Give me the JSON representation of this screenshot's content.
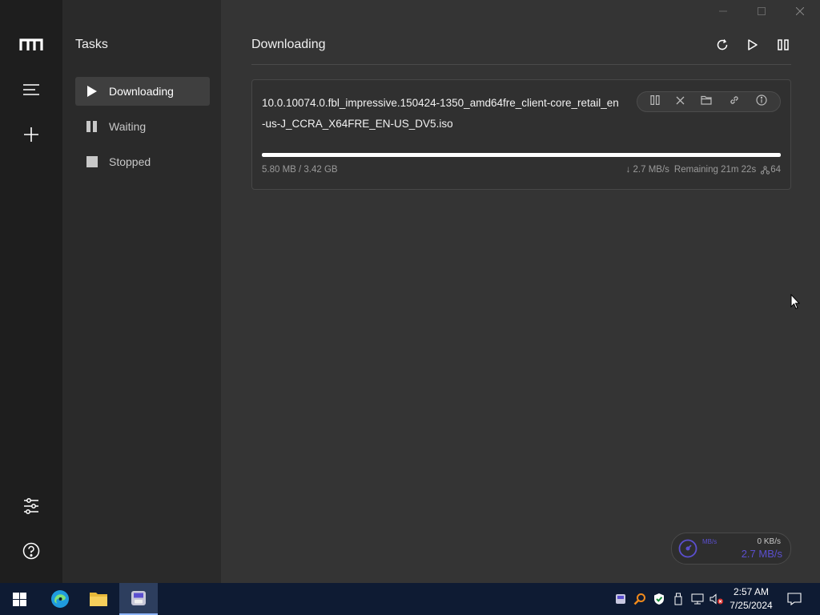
{
  "window": {
    "minimize_icon": "minimize-icon",
    "maximize_icon": "maximize-icon",
    "close_icon": "close-icon"
  },
  "rail": {
    "logo_icon": "motrix-logo-icon",
    "items": [
      "menu-icon",
      "add-icon"
    ],
    "bottom": [
      "preferences-icon",
      "help-icon"
    ]
  },
  "sidebar": {
    "title": "Tasks",
    "items": [
      {
        "label": "Downloading",
        "icon": "play-icon",
        "active": true
      },
      {
        "label": "Waiting",
        "icon": "pause-icon",
        "active": false
      },
      {
        "label": "Stopped",
        "icon": "stop-icon",
        "active": false
      }
    ]
  },
  "main": {
    "title": "Downloading",
    "actions": [
      "refresh-icon",
      "resume-all-icon",
      "pause-all-icon"
    ]
  },
  "task": {
    "name": "10.0.10074.0.fbl_impressive.150424-1350_amd64fre_client-core_retail_en-us-J_CCRA_X64FRE_EN-US_DV5.iso",
    "size": "5.80 MB / 3.42 GB",
    "progress": 0.0017,
    "speed": "↓ 2.7 MB/s",
    "remaining": "Remaining 21m 22s",
    "connections": "64",
    "actions": [
      "pause-icon",
      "delete-icon",
      "folder-icon",
      "link-icon",
      "info-icon"
    ]
  },
  "speedometer": {
    "upload": "0 KB/s",
    "download": "2.7 MB/s",
    "unit_label": "MB/s"
  },
  "taskbar": {
    "time": "2:57 AM",
    "date": "7/25/2024"
  },
  "colors": {
    "rail": "#1e1e1e",
    "sidebar": "#2a2a2a",
    "main": "#343434",
    "accent": "#5b4fcf",
    "taskbar": "#0e1b33"
  }
}
